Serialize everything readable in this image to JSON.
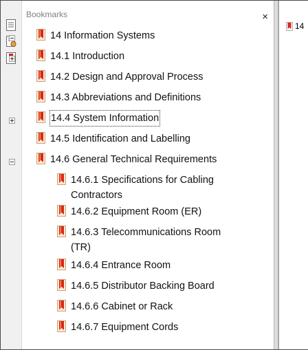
{
  "panel": {
    "title": "Bookmarks",
    "close_label": "×"
  },
  "toolstrip": {
    "icons": [
      "page-thumbnails-icon",
      "bookmark-options-icon",
      "bookmarks-panel-icon"
    ]
  },
  "doc": {
    "page_label": "14"
  },
  "bookmarks": [
    {
      "label": "14 Information Systems",
      "expander": "minus"
    },
    {
      "label": "14.1 Introduction",
      "expander": "plus"
    },
    {
      "label": "14.2 Design and Approval Process",
      "expander": ""
    },
    {
      "label": "14.3 Abbreviations and Definitions",
      "expander": ""
    },
    {
      "label": "14.4 System Information",
      "expander": "plus",
      "selected": true
    },
    {
      "label": "14.5 Identification and Labelling",
      "expander": ""
    },
    {
      "label": "14.6 General Technical Requirements",
      "expander": "minus"
    },
    {
      "label": "14.6.1 Specifications for Cabling Contractors",
      "expander": ""
    },
    {
      "label": "14.6.2 Equipment Room (ER)",
      "expander": ""
    },
    {
      "label": "14.6.3 Telecommunications Room (TR)",
      "expander": ""
    },
    {
      "label": "14.6.4 Entrance Room",
      "expander": ""
    },
    {
      "label": "14.6.5 Distributor Backing Board",
      "expander": ""
    },
    {
      "label": "14.6.6 Cabinet or Rack",
      "expander": ""
    },
    {
      "label": "14.6.7 Equipment Cords",
      "expander": ""
    }
  ],
  "colors": {
    "bookmark_red": "#d7261f",
    "bookmark_orange": "#f2a03d"
  }
}
